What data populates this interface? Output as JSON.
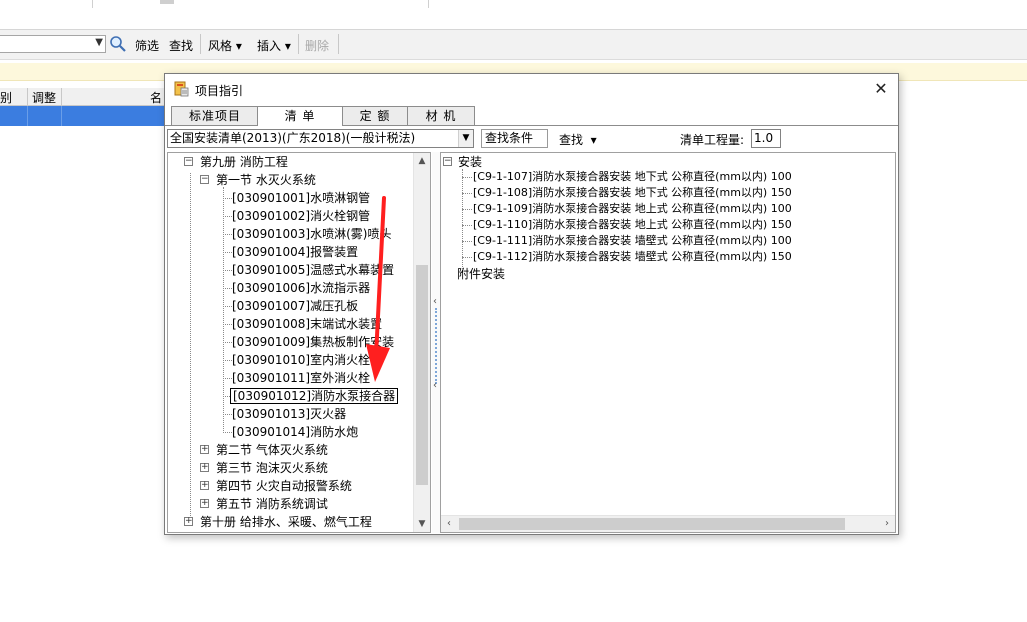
{
  "background": {
    "toolbar": {
      "filter_label": "筛选",
      "find_label": "查找",
      "style_label": "风格",
      "insert_label": "插入",
      "delete_label": "删除"
    },
    "grid": {
      "headers": [
        "别",
        "调整",
        "名"
      ]
    }
  },
  "dialog": {
    "title": "项目指引",
    "close_glyph": "✕",
    "tabs": [
      "标准项目",
      "清 单",
      "定 额",
      "材 机"
    ],
    "active_tab": 1,
    "library_select": "全国安装清单(2013)(广东2018)(一般计税法)",
    "condition_button": "查找条件",
    "find_button": "查找",
    "quantity_label": "清单工程量:",
    "quantity_value": "1.0",
    "tree": {
      "volume9": "第九册  消防工程",
      "section1": "第一节  水灭火系统",
      "items": [
        "[030901001]水喷淋钢管",
        "[030901002]消火栓钢管",
        "[030901003]水喷淋(雾)喷头",
        "[030901004]报警装置",
        "[030901005]温感式水幕装置",
        "[030901006]水流指示器",
        "[030901007]减压孔板",
        "[030901008]末端试水装置",
        "[030901009]集热板制作安装",
        "[030901010]室内消火栓",
        "[030901011]室外消火栓",
        "[030901012]消防水泵接合器",
        "[030901013]灭火器",
        "[030901014]消防水炮"
      ],
      "selected_index": 11,
      "sections": [
        "第二节  气体灭火系统",
        "第三节  泡沫灭火系统",
        "第四节  火灾自动报警系统",
        "第五节  消防系统调试"
      ],
      "volume10": "第十册  给排水、采暖、燃气工程"
    },
    "right": {
      "group_install": "安装",
      "install_items": [
        "[C9-1-107]消防水泵接合器安装 地下式 公称直径(mm以内) 100",
        "[C9-1-108]消防水泵接合器安装 地下式 公称直径(mm以内) 150",
        "[C9-1-109]消防水泵接合器安装 地上式 公称直径(mm以内) 100",
        "[C9-1-110]消防水泵接合器安装 地上式 公称直径(mm以内) 150",
        "[C9-1-111]消防水泵接合器安装 墙壁式 公称直径(mm以内) 100",
        "[C9-1-112]消防水泵接合器安装 墙壁式 公称直径(mm以内) 150"
      ],
      "group_accessory": "附件安装"
    }
  },
  "colors": {
    "selection_blue": "#3b7de0",
    "notice_yellow": "#fdf8dc",
    "annotation_red": "#ff1f1f"
  }
}
